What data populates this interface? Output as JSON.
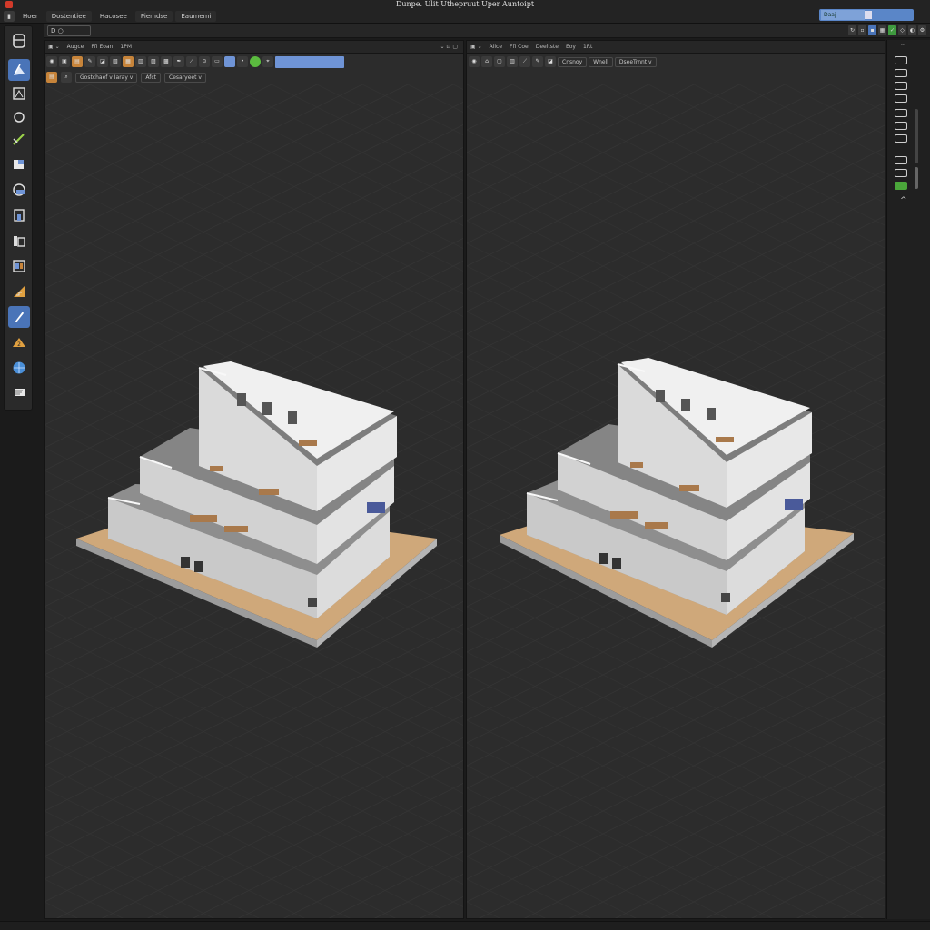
{
  "window": {
    "title": "Dunpe.  Ulit  Uthepruut  Uper  Auntoipt"
  },
  "menu": {
    "items": [
      "Hoer",
      "Dostentiee",
      "Hacosee",
      "Piemdse",
      "Eaumemi"
    ]
  },
  "topright": {
    "field_value": "Daaj"
  },
  "header2": {
    "mode_label": "D ○"
  },
  "left_toolbar": {
    "tools": [
      "cube-icon",
      "select-icon",
      "move-icon",
      "circle-icon",
      "brush-icon",
      "material-icon",
      "camera-icon",
      "door-icon",
      "wall-icon",
      "window-icon",
      "stair-icon",
      "pen-icon",
      "roof-icon",
      "globe-icon",
      "note-icon"
    ],
    "active": "pen-icon"
  },
  "viewport_left": {
    "header": [
      "Augce",
      "Ffi  Eoan",
      "1PM"
    ],
    "dropdowns": [
      "Gostchaef  v  Iaray v",
      "Afct",
      "Cesaryeet v"
    ]
  },
  "viewport_right": {
    "header": [
      "Aiice",
      "Ffi  Coe",
      "Deeltste",
      "Eoy",
      "1Rt"
    ],
    "dropdowns": [
      "Cnsnoy",
      "Wnell",
      "DseeTrnnt v"
    ]
  },
  "colors": {
    "accent": "#4a74b8",
    "toolbar_blue": "#6f94d6",
    "floor": "#c9a57c",
    "walls": "#e4e4e4",
    "viewport_bg": "#2c2c2c"
  }
}
